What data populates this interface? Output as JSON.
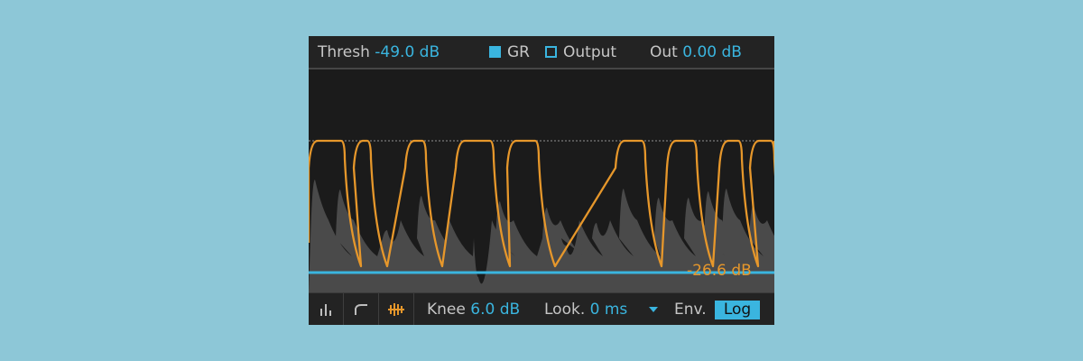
{
  "header": {
    "thresh_label": "Thresh",
    "thresh_value": "-49.0 dB",
    "gr_label": "GR",
    "output_label": "Output",
    "out_label": "Out",
    "out_value": "0.00 dB"
  },
  "graph": {
    "gr_readout": "-26.6 dB"
  },
  "footer": {
    "knee_label": "Knee",
    "knee_value": "6.0 dB",
    "lookahead_label": "Look.",
    "lookahead_value": "0 ms",
    "env_label": "Env.",
    "env_value": "Log"
  },
  "icons": [
    "bar-meter-icon",
    "curve-icon",
    "waveform-activity-icon",
    "triangle-down-icon"
  ],
  "colors": {
    "background": "#8dc7d7",
    "accent_blue": "#3ab5df",
    "accent_orange": "#e6972b",
    "panel": "#1b1b1b",
    "waveform": "#4a4a4a"
  }
}
